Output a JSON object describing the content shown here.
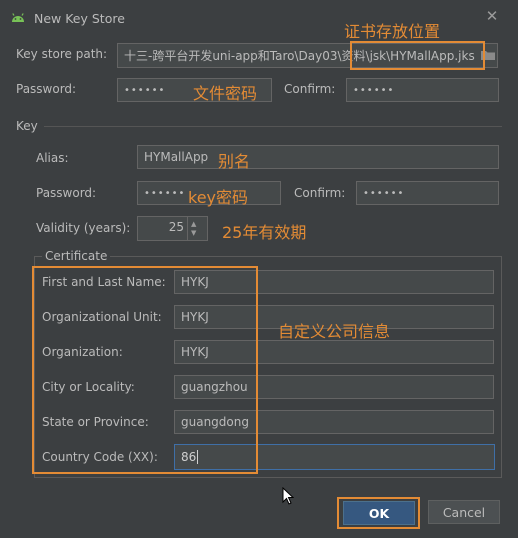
{
  "window": {
    "title": "New Key Store"
  },
  "keystore": {
    "path_label": "Key store path:",
    "path_value": "十三-跨平台开发uni-app和Taro\\Day03\\资料\\jsk\\HYMallApp.jks",
    "password_label": "Password:",
    "password_value": "••••••",
    "confirm_label": "Confirm:",
    "confirm_value": "••••••"
  },
  "key": {
    "section_label": "Key",
    "alias_label": "Alias:",
    "alias_value": "HYMallApp",
    "password_label": "Password:",
    "password_value": "••••••",
    "confirm_label": "Confirm:",
    "confirm_value": "••••••",
    "validity_label": "Validity (years):",
    "validity_value": "25"
  },
  "certificate": {
    "legend": "Certificate",
    "fields": [
      {
        "label": "First and Last Name:",
        "value": "HYKJ"
      },
      {
        "label": "Organizational Unit:",
        "value": "HYKJ"
      },
      {
        "label": "Organization:",
        "value": "HYKJ"
      },
      {
        "label": "City or Locality:",
        "value": "guangzhou"
      },
      {
        "label": "State or Province:",
        "value": "guangdong"
      },
      {
        "label": "Country Code (XX):",
        "value": "86"
      }
    ]
  },
  "annotations": {
    "path": "证书存放位置",
    "file_password": "文件密码",
    "alias": "别名",
    "key_password": "key密码",
    "validity": "25年有效期",
    "company_info": "自定义公司信息"
  },
  "buttons": {
    "ok": "OK",
    "cancel": "Cancel"
  },
  "colors": {
    "annotation": "#e38b35",
    "accent": "#365880",
    "background": "#3c3f41"
  }
}
